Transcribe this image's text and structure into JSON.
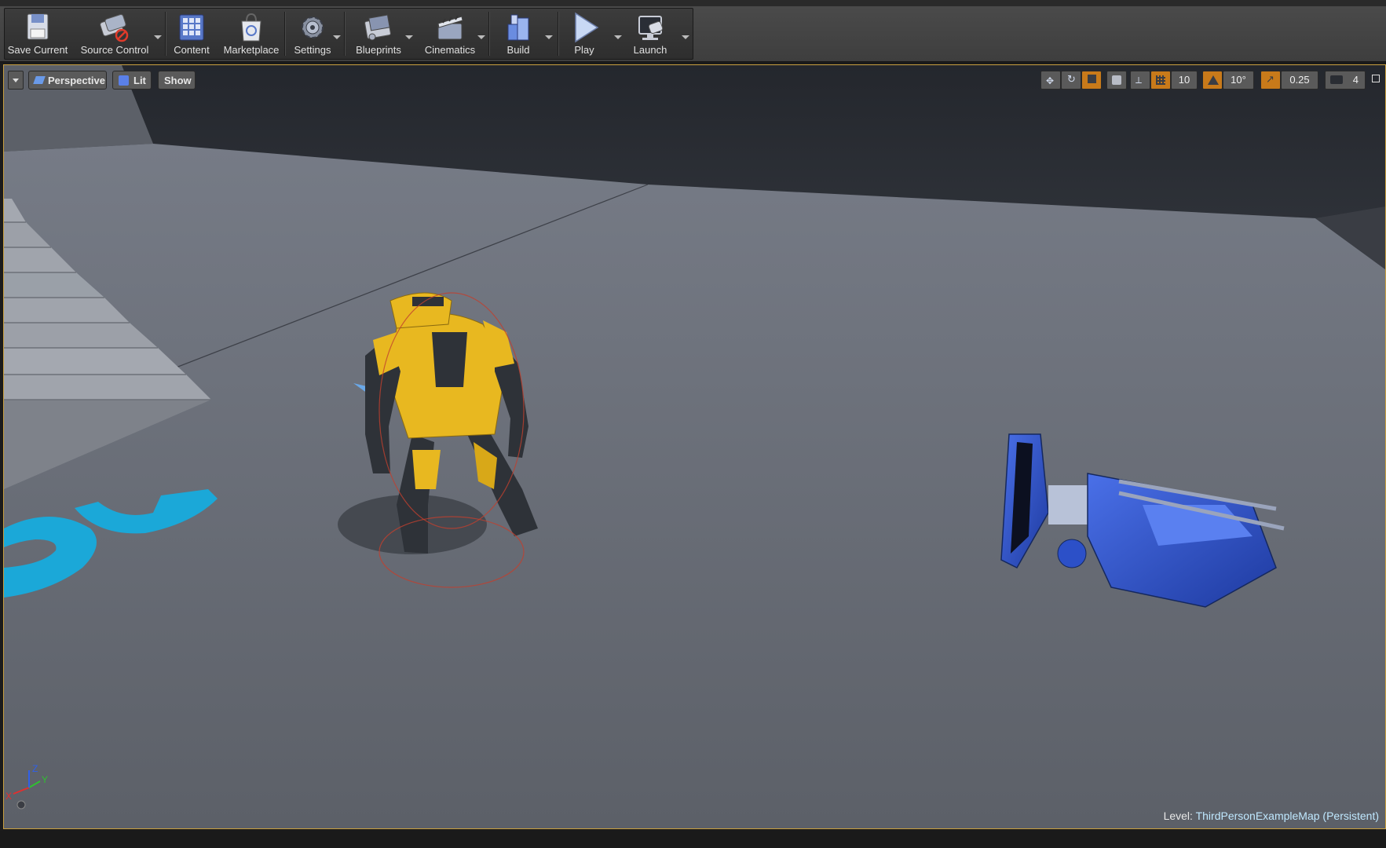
{
  "toolbar": {
    "items": [
      {
        "label": "Save Current",
        "icon": "save-icon"
      },
      {
        "label": "Source Control",
        "icon": "source-control-icon"
      },
      {
        "label": "Content",
        "icon": "content-icon"
      },
      {
        "label": "Marketplace",
        "icon": "marketplace-icon"
      },
      {
        "label": "Settings",
        "icon": "settings-icon"
      },
      {
        "label": "Blueprints",
        "icon": "blueprints-icon"
      },
      {
        "label": "Cinematics",
        "icon": "cinematics-icon"
      },
      {
        "label": "Build",
        "icon": "build-icon"
      },
      {
        "label": "Play",
        "icon": "play-icon"
      },
      {
        "label": "Launch",
        "icon": "launch-icon"
      }
    ]
  },
  "viewport": {
    "view_mode": "Perspective",
    "lighting_mode": "Lit",
    "show_label": "Show",
    "grid_snap_value": "10",
    "rotation_snap_value": "10°",
    "scale_snap_value": "0.25",
    "camera_speed_value": "4",
    "level_prefix": "Level:",
    "level_name": "ThirdPersonExampleMap (Persistent)",
    "axis_labels": {
      "x": "X",
      "y": "Y",
      "z": "Z"
    }
  },
  "colors": {
    "selection_border": "#c9a040",
    "robot_yellow": "#e8b820",
    "camera_blue": "#2c50c8",
    "floor_text_cyan": "#1ba8d8",
    "snap_orange": "#c87a1a"
  }
}
